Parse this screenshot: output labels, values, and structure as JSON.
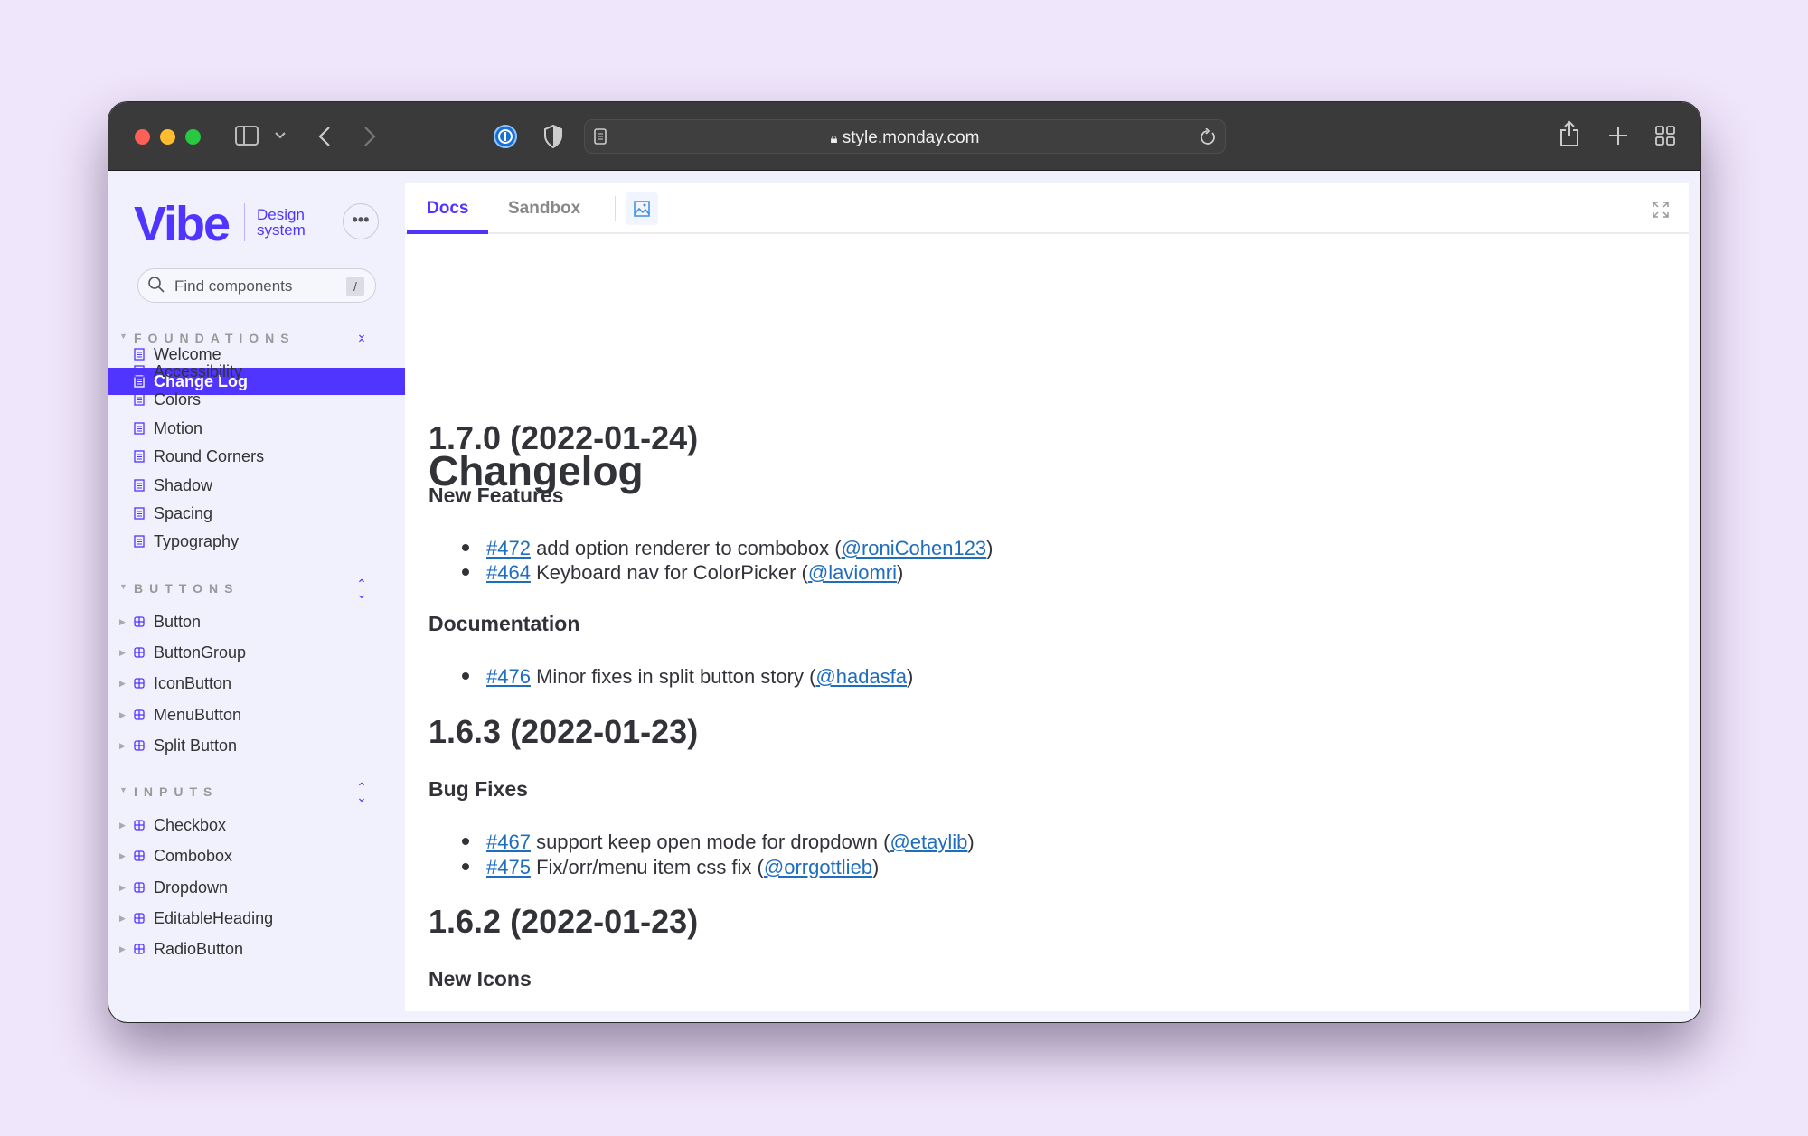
{
  "browser": {
    "url": "style.monday.com"
  },
  "sidebar": {
    "logo": "Vibe",
    "logo_sub_1": "Design",
    "logo_sub_2": "system",
    "search_placeholder": "Find components",
    "search_shortcut": "/",
    "top_items": [
      {
        "label": "Welcome",
        "selected": false
      },
      {
        "label": "Change Log",
        "selected": true
      }
    ],
    "sections": [
      {
        "title": "FOUNDATIONS",
        "icon": "doc",
        "items": [
          "Accessibility",
          "Colors",
          "Motion",
          "Round Corners",
          "Shadow",
          "Spacing",
          "Typography"
        ]
      },
      {
        "title": "BUTTONS",
        "icon": "component",
        "items": [
          "Button",
          "ButtonGroup",
          "IconButton",
          "MenuButton",
          "Split Button"
        ]
      },
      {
        "title": "INPUTS",
        "icon": "component",
        "items": [
          "Checkbox",
          "Combobox",
          "Dropdown",
          "EditableHeading",
          "RadioButton"
        ]
      }
    ]
  },
  "tabs": [
    {
      "label": "Docs",
      "active": true
    },
    {
      "label": "Sandbox",
      "active": false
    }
  ],
  "doc": {
    "title": "Changelog",
    "blocks": [
      {
        "type": "h2",
        "text": "1.7.0 (2022-01-24)"
      },
      {
        "type": "h3",
        "text": "New Features"
      },
      {
        "type": "li",
        "pr": "#472",
        "text": " add option renderer to combobox (",
        "user": "@roniCohen123"
      },
      {
        "type": "li",
        "pr": "#464",
        "text": " Keyboard nav for ColorPicker (",
        "user": "@laviomri"
      },
      {
        "type": "h3",
        "text": "Documentation"
      },
      {
        "type": "li",
        "pr": "#476",
        "text": " Minor fixes in split button story (",
        "user": "@hadasfa"
      },
      {
        "type": "h2",
        "text": "1.6.3 (2022-01-23)"
      },
      {
        "type": "h3",
        "text": "Bug Fixes"
      },
      {
        "type": "li",
        "pr": "#467",
        "text": " support keep open mode for dropdown (",
        "user": "@etaylib"
      },
      {
        "type": "li",
        "pr": "#475",
        "text": " Fix/orr/menu item css fix (",
        "user": "@orrgottlieb"
      },
      {
        "type": "h2",
        "text": "1.6.2 (2022-01-23)"
      },
      {
        "type": "h3",
        "text": "New Icons"
      }
    ],
    "close_paren": ")"
  },
  "colors": {
    "brand": "#5034ff",
    "link": "#1f6dbf",
    "text": "#323338",
    "background": "#f0e6fb"
  }
}
